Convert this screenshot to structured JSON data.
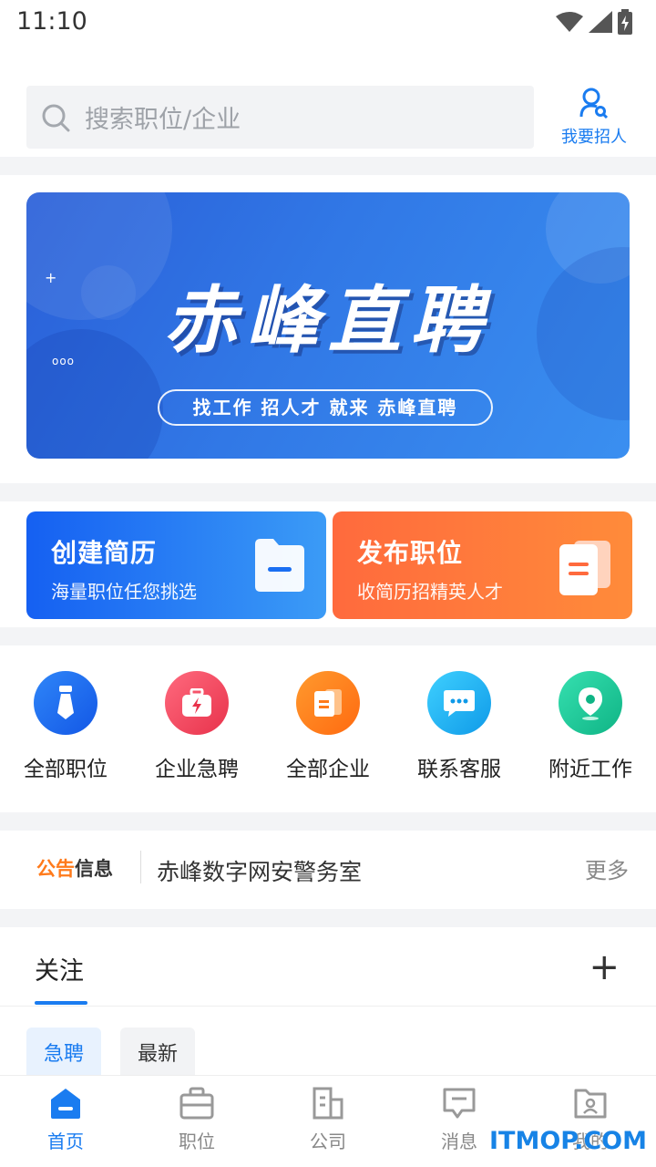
{
  "status": {
    "time": "11:10"
  },
  "search": {
    "placeholder": "搜索职位/企业"
  },
  "header": {
    "recruit_label": "我要招人"
  },
  "banner": {
    "title": "赤峰直聘",
    "subtitle": "找工作 招人才 就来 赤峰直聘"
  },
  "quick": {
    "resume": {
      "title": "创建简历",
      "sub": "海量职位任您挑选"
    },
    "post": {
      "title": "发布职位",
      "sub": "收简历招精英人才"
    }
  },
  "nav": [
    {
      "label": "全部职位",
      "color": "#1d6ff2"
    },
    {
      "label": "企业急聘",
      "color": "#f0485f"
    },
    {
      "label": "全部企业",
      "color": "#ff7a1a"
    },
    {
      "label": "联系客服",
      "color": "#16aaf0"
    },
    {
      "label": "附近工作",
      "color": "#1fc79a"
    }
  ],
  "notice": {
    "tag_a": "公告",
    "tag_b": "信息",
    "text": "赤峰数字网安警务室",
    "more": "更多"
  },
  "follow": {
    "title": "关注",
    "add": "+",
    "chips": [
      "急聘",
      "最新"
    ]
  },
  "tabs": [
    {
      "label": "首页",
      "active": true
    },
    {
      "label": "职位"
    },
    {
      "label": "公司"
    },
    {
      "label": "消息"
    },
    {
      "label": "我的"
    }
  ],
  "watermark": "ITMOP.COM",
  "colors": {
    "accent": "#1a7cf0",
    "orange": "#ff7a1a"
  }
}
